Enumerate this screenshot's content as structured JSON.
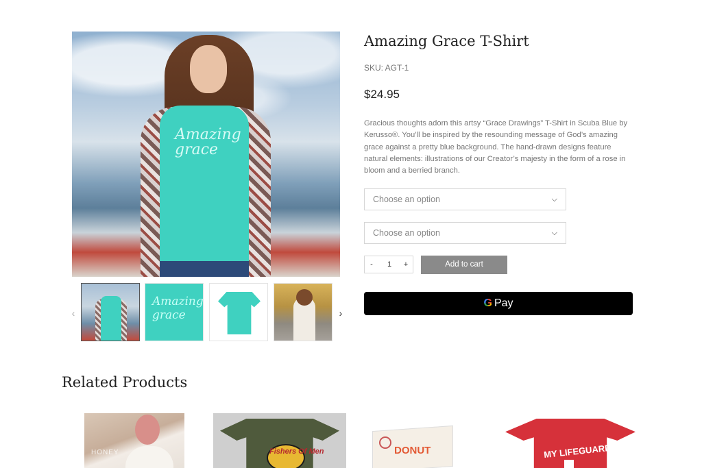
{
  "product": {
    "title": "Amazing Grace T-Shirt",
    "sku": "SKU: AGT-1",
    "price": "$24.95",
    "description": "Gracious thoughts adorn this artsy “Grace Drawings” T-Shirt in Scuba Blue by Kerusso®. You’ll be inspired by the resounding message of God’s amazing grace against a pretty blue background. The hand-drawn designs feature natural elements: illustrations of our Creator’s majesty in the form of a rose in bloom and a berried branch.",
    "shirt_print": "Amazing grace"
  },
  "options": {
    "select1_placeholder": "Choose an option",
    "select2_placeholder": "Choose an option"
  },
  "cart": {
    "minus": "-",
    "quantity": "1",
    "plus": "+",
    "add_to_cart": "Add to cart",
    "gpay_g": "G",
    "gpay_label": "Pay"
  },
  "gallery": {
    "prev_icon": "‹",
    "next_icon": "›",
    "thumb2_text": "Amazing grace"
  },
  "related": {
    "title": "Related Products",
    "item1_text": "HONEY",
    "item2_text": "Fishers Of Men",
    "item3_text": "DONUT",
    "item4_text": "MY LIFEGUARD"
  },
  "colors": {
    "accent_teal": "#3fd1c0",
    "button_gray": "#8a8a8a",
    "gpay_black": "#000000"
  }
}
